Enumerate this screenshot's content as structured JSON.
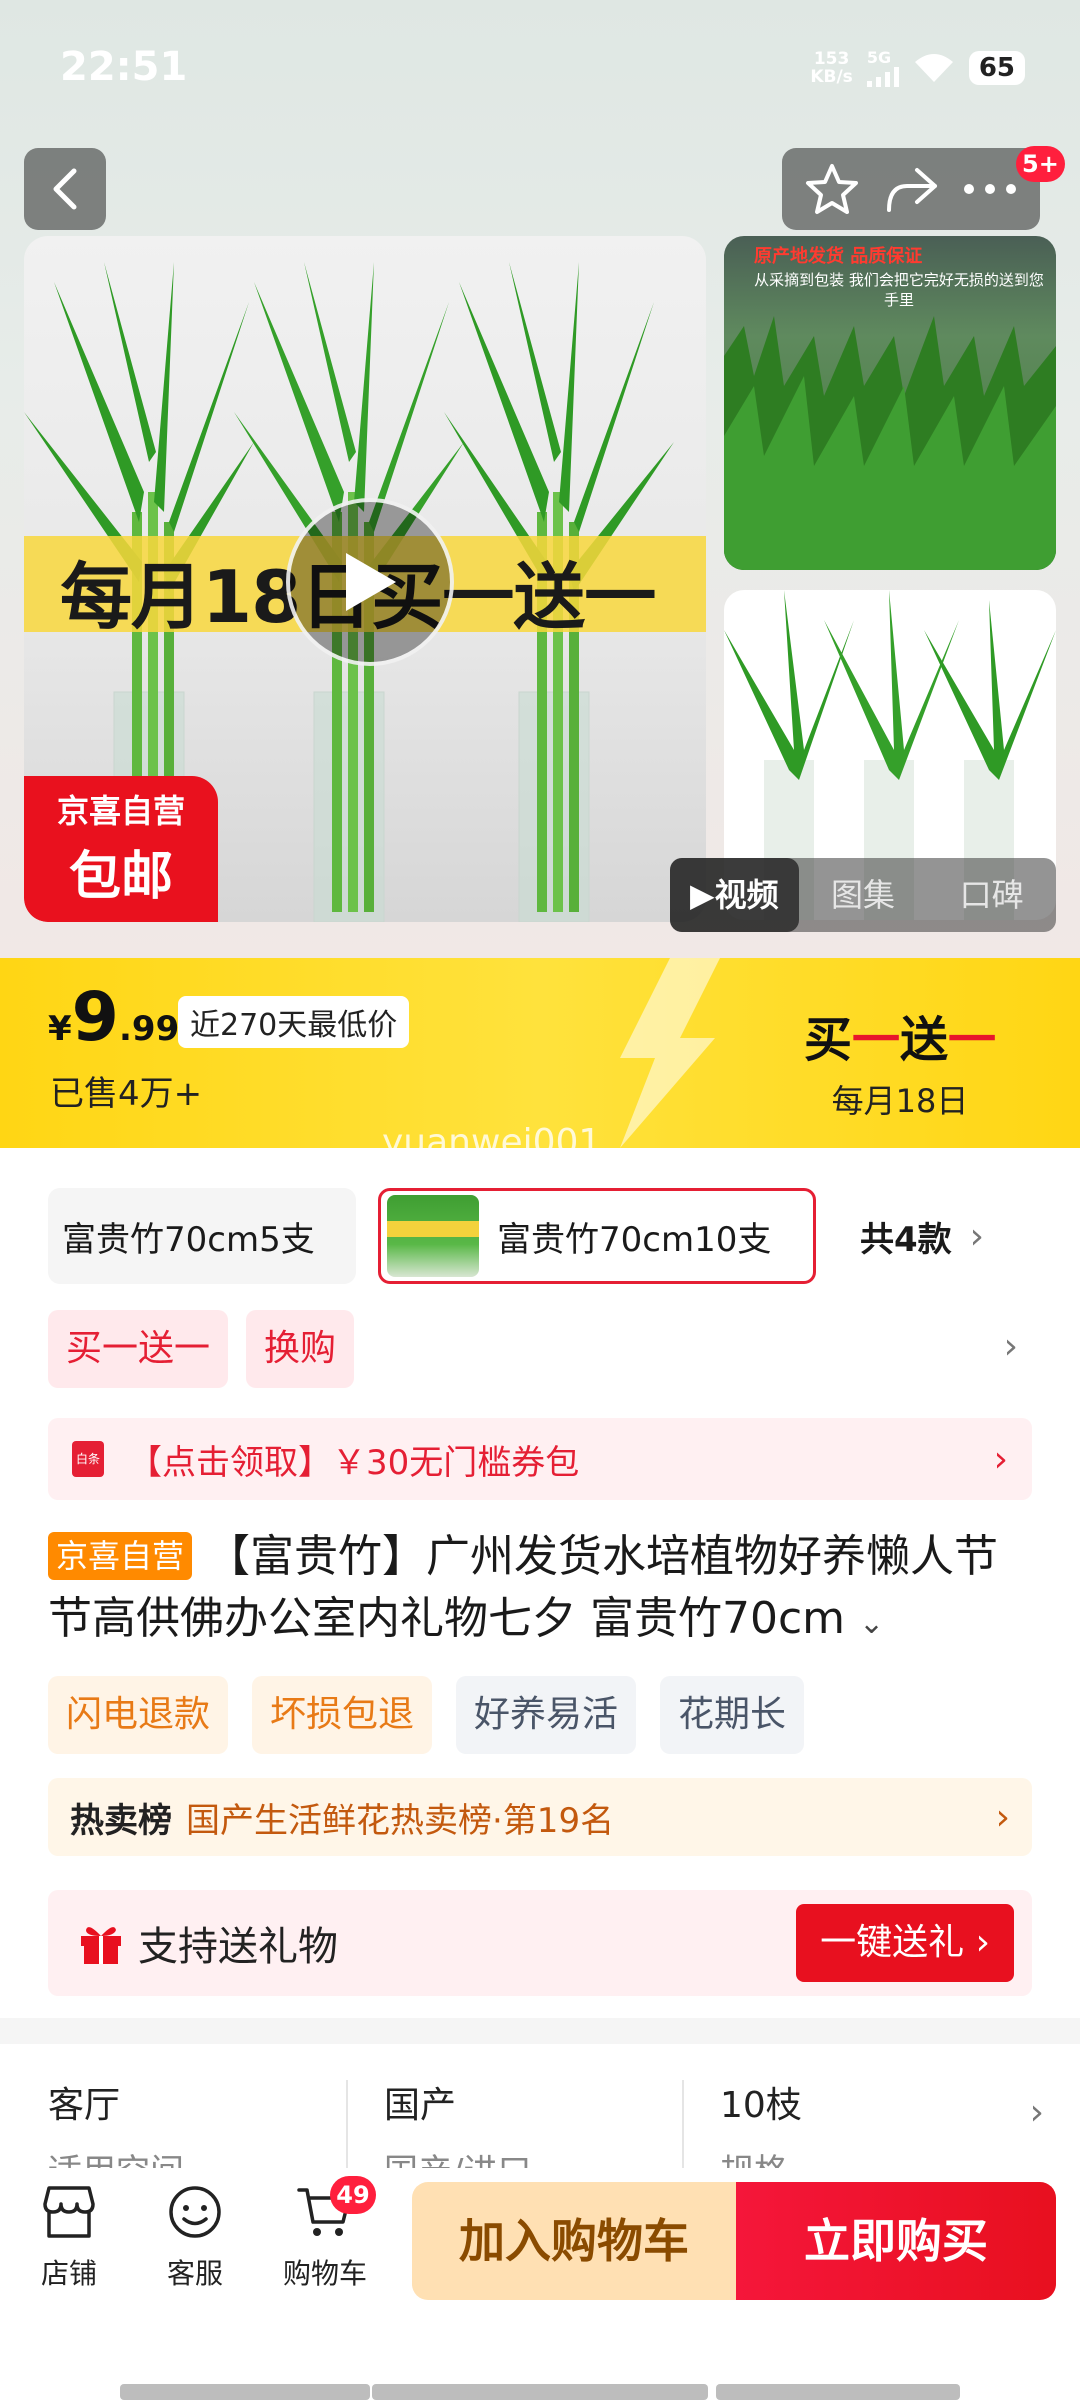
{
  "status_bar": {
    "time": "22:51",
    "net_speed": "153",
    "net_unit": "KB/s",
    "net_type": "5G",
    "battery": "65"
  },
  "header": {
    "notification_badge": "5+",
    "icons": [
      "back-icon",
      "star-icon",
      "share-icon",
      "more-icon"
    ]
  },
  "gallery": {
    "promo_text": "每月18日买一送一",
    "ship_badge_top": "京喜自营",
    "ship_badge_bottom": "包邮",
    "side_banner_red": "原产地发货 品质保证",
    "side_banner_white": "从采摘到包装 我们会把它完好无损的送到您手里",
    "tabs": [
      "视频",
      "图集",
      "口碑"
    ],
    "active_tab": "视频"
  },
  "price": {
    "currency": "¥",
    "integer": "9",
    "decimal": ".99",
    "low_tag": "近270天最低价",
    "sold": "已售4万+",
    "promo_main_1": "买",
    "promo_main_2": "一",
    "promo_main_3": "送",
    "promo_main_4": "一",
    "promo_sub": "每月18日"
  },
  "watermark": "yuanwei001",
  "skus": {
    "items": [
      "富贵竹70cm5支",
      "富贵竹70cm10支"
    ],
    "selected": "富贵竹70cm10支",
    "total": "共4款"
  },
  "promo_tags": [
    "买一送一",
    "换购"
  ],
  "coupon": {
    "icon_text": "白条",
    "text": "【点击领取】￥30无门槛券包"
  },
  "product": {
    "badge": "京喜自营",
    "title": "【富贵竹】广州发货水培植物好养懒人节节高供佛办公室内礼物七夕 富贵竹70cm"
  },
  "feature_tags": [
    "闪电退款",
    "坏损包退",
    "好养易活",
    "花期长"
  ],
  "rank": {
    "label": "热卖榜",
    "text": "国产生活鲜花热卖榜·第19名"
  },
  "gift": {
    "label": "支持送礼物",
    "button": "一键送礼 ›"
  },
  "specs": [
    {
      "value": "客厅",
      "key": "适用空间"
    },
    {
      "value": "国产",
      "key": "国产/进口"
    },
    {
      "value": "10枝",
      "key": "规格"
    }
  ],
  "bottom_nav": {
    "items": [
      "店铺",
      "客服",
      "购物车"
    ],
    "cart_count": "49",
    "add_to_cart": "加入购物车",
    "buy_now": "立即购买"
  },
  "colors": {
    "brand_red": "#e8101f",
    "price_yellow": "#ffd614",
    "cart_btn": "#ffe0b3"
  }
}
